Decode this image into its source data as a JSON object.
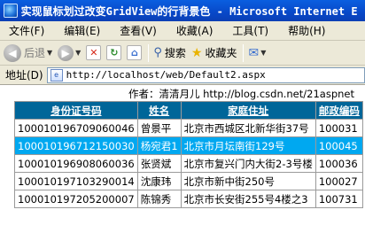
{
  "window": {
    "title": "实现鼠标划过改变GridView的行背景色 - Microsoft Internet E"
  },
  "menu": [
    "文件(F)",
    "编辑(E)",
    "查看(V)",
    "收藏(A)",
    "工具(T)",
    "帮助(H)"
  ],
  "toolbar": {
    "back_label": "后退",
    "search_label": "搜索",
    "favorites_label": "收藏夹"
  },
  "address": {
    "label": "地址(D)",
    "url": "http://localhost/web/Default2.aspx"
  },
  "page": {
    "author_line": "作者：清清月儿 http://blog.csdn.net/21aspnet",
    "columns": [
      "身份证号码",
      "姓名",
      "家庭住址",
      "邮政编码"
    ],
    "highlight_color": "#00a8f0",
    "header_color": "#006699",
    "rows": [
      {
        "id": "100010196709060046",
        "name": "曾景平",
        "address": "北京市西城区北新华街37号",
        "zip": "100031",
        "highlighted": false
      },
      {
        "id": "100010196712150030",
        "name": "杨宛君1",
        "address": "北京市月坛南街129号",
        "zip": "100045",
        "highlighted": true
      },
      {
        "id": "100010196908060036",
        "name": "张贤斌",
        "address": "北京市复兴门内大街2-3号楼",
        "zip": "100036",
        "highlighted": false
      },
      {
        "id": "100010197103290014",
        "name": "沈康玮",
        "address": "北京市新中街250号",
        "zip": "100027",
        "highlighted": false
      },
      {
        "id": "100010197205200007",
        "name": "陈锦秀",
        "address": "北京市长安街255号4楼之3",
        "zip": "100731",
        "highlighted": false
      }
    ]
  }
}
